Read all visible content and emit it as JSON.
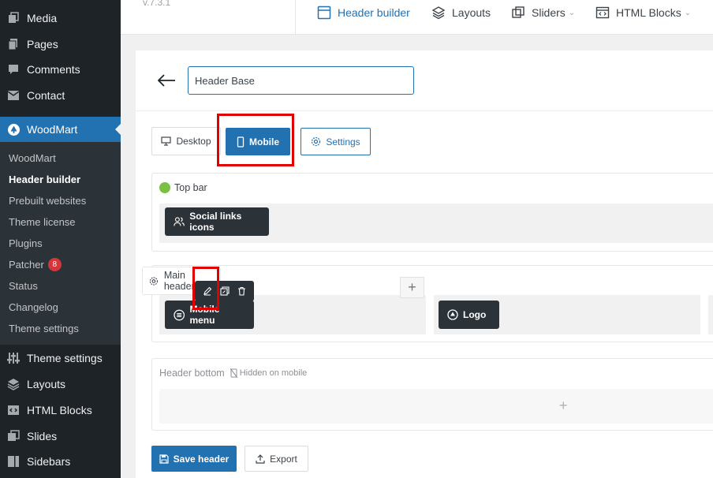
{
  "sidebar": {
    "top_items": [
      {
        "label": "Media",
        "icon": "media-icon"
      },
      {
        "label": "Pages",
        "icon": "pages-icon"
      },
      {
        "label": "Comments",
        "icon": "comments-icon"
      },
      {
        "label": "Contact",
        "icon": "mail-icon"
      }
    ],
    "active_item": {
      "label": "WoodMart",
      "icon": "woodmart-icon"
    },
    "submenu": [
      {
        "label": "WoodMart"
      },
      {
        "label": "Header builder"
      },
      {
        "label": "Prebuilt websites"
      },
      {
        "label": "Theme license"
      },
      {
        "label": "Plugins"
      },
      {
        "label": "Patcher",
        "badge": "8"
      },
      {
        "label": "Status"
      },
      {
        "label": "Changelog"
      },
      {
        "label": "Theme settings"
      }
    ],
    "bottom_items": [
      {
        "label": "Theme settings",
        "icon": "sliders-icon"
      },
      {
        "label": "Layouts",
        "icon": "layers-icon"
      },
      {
        "label": "HTML Blocks",
        "icon": "code-icon"
      },
      {
        "label": "Slides",
        "icon": "slides-icon"
      },
      {
        "label": "Sidebars",
        "icon": "sidebar-icon"
      }
    ]
  },
  "topbar": {
    "version": "v.7.3.1",
    "nav": [
      {
        "label": "Header builder",
        "icon": "header-icon",
        "active": true
      },
      {
        "label": "Layouts",
        "icon": "layers-icon"
      },
      {
        "label": "Sliders",
        "icon": "slider-icon",
        "dropdown": true
      },
      {
        "label": "HTML Blocks",
        "icon": "html-icon",
        "dropdown": true
      }
    ]
  },
  "editor": {
    "header_name": "Header Base",
    "view_buttons": {
      "desktop": "Desktop",
      "mobile": "Mobile",
      "settings": "Settings"
    },
    "rows": {
      "top_bar": {
        "label": "Top bar",
        "elements": [
          "Social links icons"
        ]
      },
      "main_header": {
        "label": "Main header",
        "elements": [
          "Mobile menu",
          "Logo"
        ]
      },
      "header_bottom": {
        "label": "Header bottom",
        "note": "Hidden on mobile"
      }
    },
    "actions": {
      "save": "Save header",
      "export": "Export"
    },
    "plus": "+"
  },
  "colors": {
    "sidebar_bg": "#1d2327",
    "submenu_bg": "#2c3338",
    "accent": "#2271b1",
    "highlight": "#e00000",
    "status_green": "#7ac143",
    "badge_red": "#d63638"
  }
}
